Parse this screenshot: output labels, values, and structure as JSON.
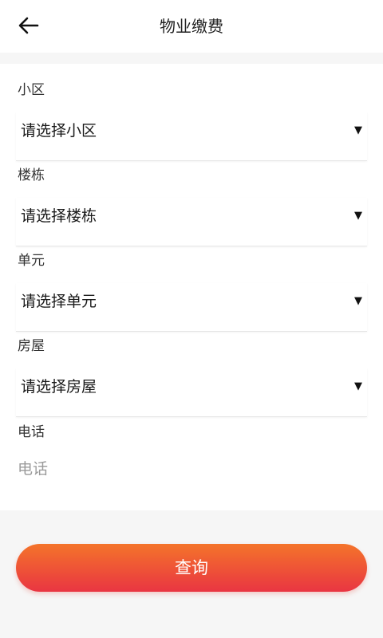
{
  "header": {
    "title": "物业缴费"
  },
  "form": {
    "fields": [
      {
        "label": "小区",
        "value": "请选择小区"
      },
      {
        "label": "楼栋",
        "value": "请选择楼栋"
      },
      {
        "label": "单元",
        "value": "请选择单元"
      },
      {
        "label": "房屋",
        "value": "请选择房屋"
      }
    ],
    "phone": {
      "label": "电话",
      "placeholder": "电话",
      "value": ""
    }
  },
  "actions": {
    "query_label": "查询"
  },
  "icons": {
    "back": "arrow-left-icon",
    "caret": "caret-down-icon"
  },
  "colors": {
    "button_gradient_top": "#f4742a",
    "button_gradient_bottom": "#e93542"
  }
}
